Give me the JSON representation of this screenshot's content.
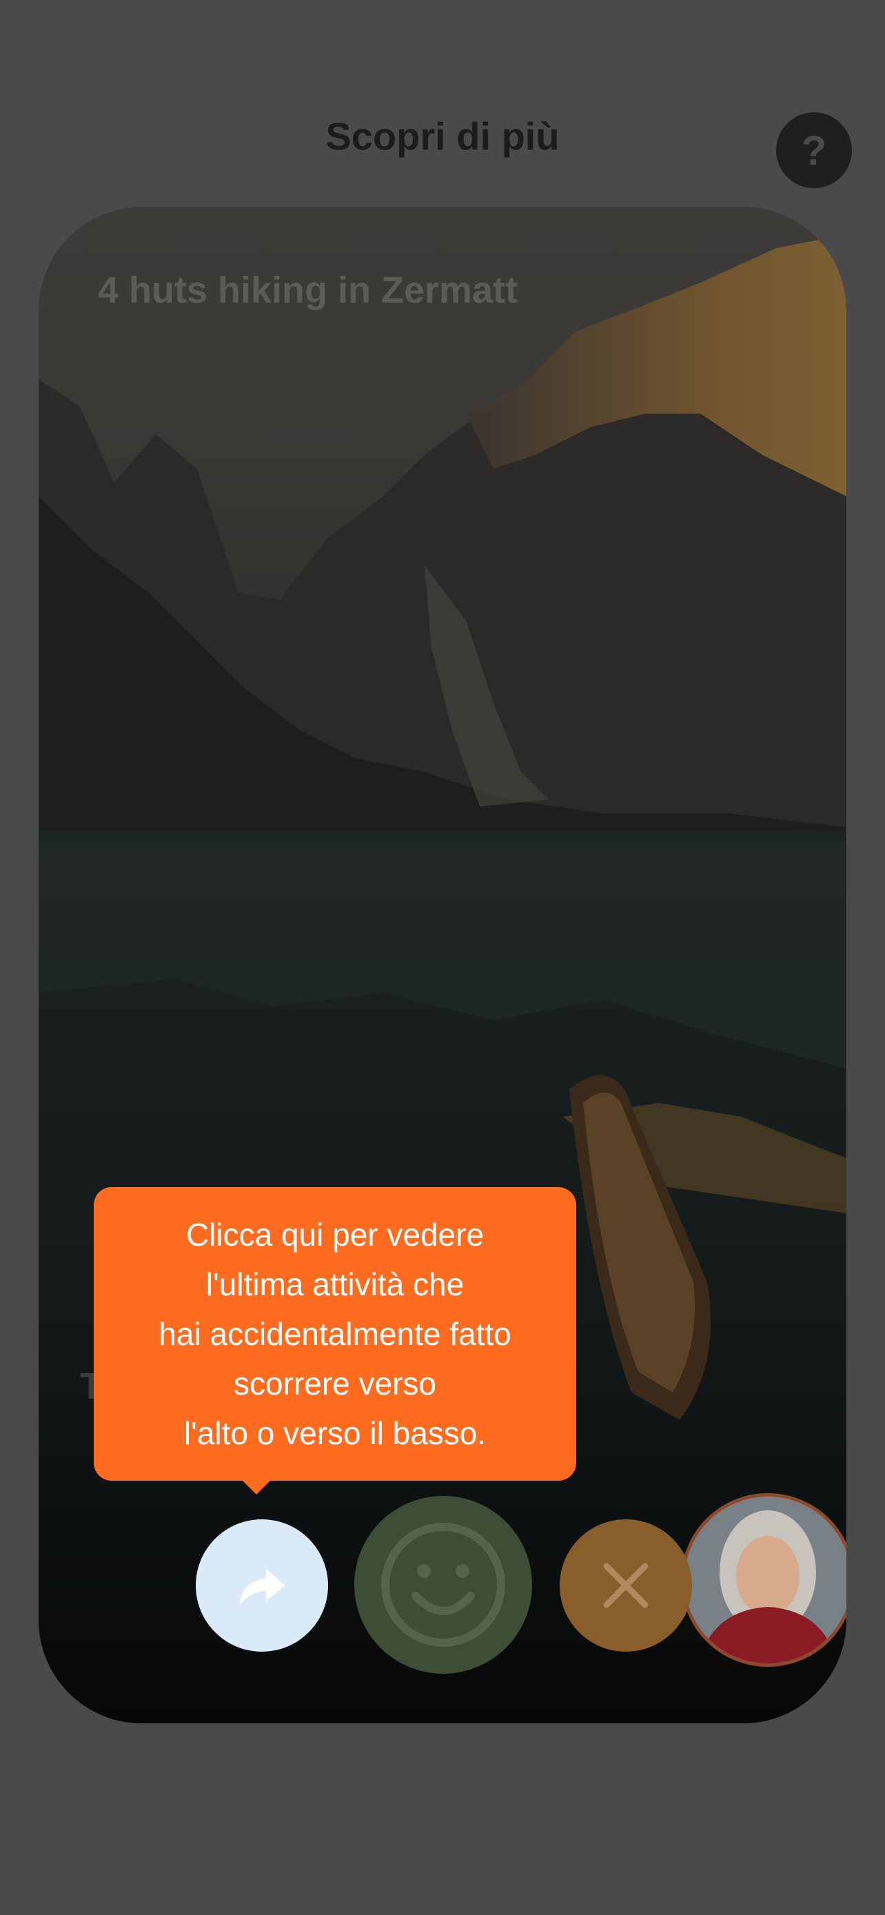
{
  "header": {
    "title": "Scopri di più",
    "help_icon_glyph": "?"
  },
  "card": {
    "title": "4 huts hiking in Zermatt",
    "subtitle_hidden": "T"
  },
  "tooltip": {
    "lines": [
      "Clicca qui per vedere",
      "l'ultima attività che",
      "hai accidentalmente fatto",
      "scorrere verso",
      "l'alto o verso il basso."
    ]
  },
  "actions": {
    "undo_icon": "redo-arrow-icon",
    "like_icon": "smiley-icon",
    "dislike_icon": "close-icon"
  },
  "colors": {
    "tooltip_bg": "#ff6b1f",
    "undo_bg": "#dbeaf8",
    "like_bg": "#3d4d36",
    "dislike_bg": "#8a5e2b",
    "overlay": "#4a4a4a"
  }
}
